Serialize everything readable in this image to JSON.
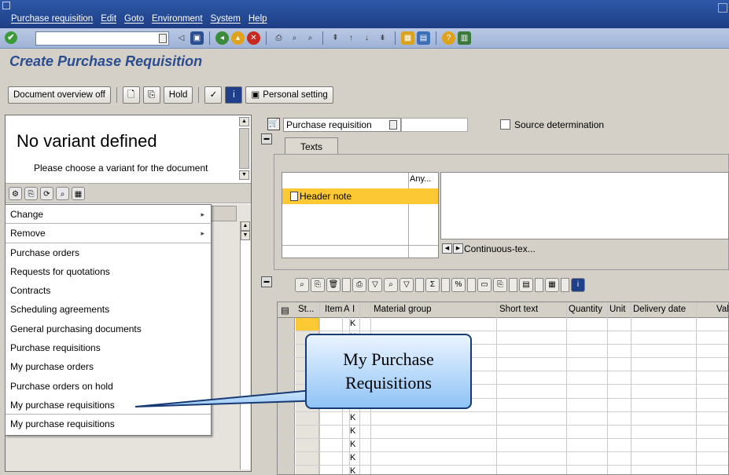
{
  "menubar": {
    "items": [
      "Purchase requisition",
      "Edit",
      "Goto",
      "Environment",
      "System",
      "Help"
    ]
  },
  "page_title": "Create Purchase Requisition",
  "app_toolbar": {
    "doc_overview": "Document overview off",
    "hold": "Hold",
    "personal_setting": "Personal setting"
  },
  "variant_panel": {
    "title": "No variant defined",
    "hint": "Please choose a variant for the document"
  },
  "context_menu": {
    "items": [
      {
        "label": "Change"
      },
      {
        "label": "Remove"
      },
      {
        "label": "Purchase orders"
      },
      {
        "label": "Requests for quotations"
      },
      {
        "label": "Contracts"
      },
      {
        "label": "Scheduling agreements"
      },
      {
        "label": "General purchasing documents"
      },
      {
        "label": "Purchase requisitions"
      },
      {
        "label": "My purchase orders"
      },
      {
        "label": "Purchase orders on hold"
      },
      {
        "label": "My purchase requisitions"
      },
      {
        "label": "My purchase requisitions"
      }
    ]
  },
  "header": {
    "doc_type": "Purchase requisition",
    "source_determination": "Source determination",
    "tab_texts": "Texts",
    "any_col": "Any...",
    "header_note": "Header note",
    "continuous_text": "Continuous-tex..."
  },
  "item_grid": {
    "columns": [
      "St...",
      "Item",
      "A",
      "I",
      "Material group",
      "Short text",
      "Quantity",
      "Unit",
      "Delivery date",
      "Val"
    ],
    "row_marker": "K"
  },
  "callout": {
    "line1": "My Purchase",
    "line2": "Requisitions"
  },
  "colors": {
    "title_blue": "#2a4d8f",
    "highlight_yellow": "#fcc934",
    "menubar_blue": "#1e3f86"
  }
}
